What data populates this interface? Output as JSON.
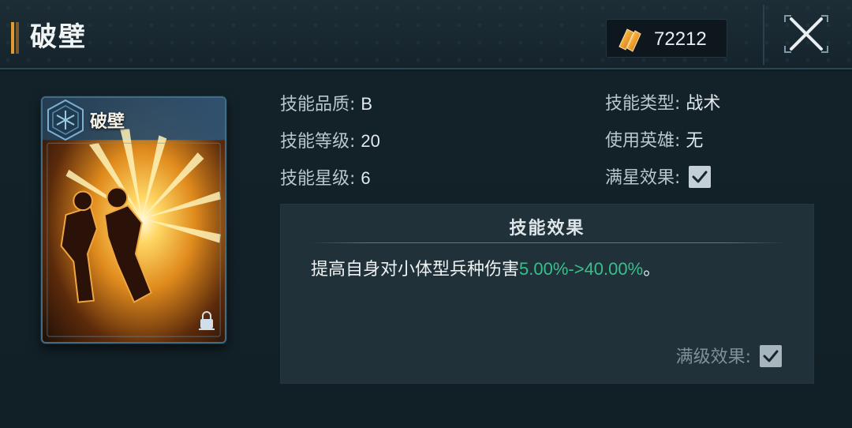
{
  "header": {
    "title": "破壁",
    "currency": {
      "icon": "crystal-icon",
      "value": "72212"
    },
    "close_icon": "close-icon"
  },
  "card": {
    "name": "破壁",
    "emblem_icon": "hex-emblem-icon",
    "lock_icon": "lock-icon"
  },
  "stats": {
    "quality": {
      "label": "技能品质:",
      "value": "B"
    },
    "level": {
      "label": "技能等级:",
      "value": "20"
    },
    "stars": {
      "label": "技能星级:",
      "value": "6"
    },
    "type": {
      "label": "技能类型:",
      "value": "战术"
    },
    "hero": {
      "label": "使用英雄:",
      "value": "无"
    },
    "max_star_effect": {
      "label": "满星效果:",
      "checked": true
    }
  },
  "effect": {
    "title": "技能效果",
    "text_prefix": "提高自身对小体型兵种伤害",
    "text_highlight": "5.00%->40.00%",
    "text_suffix": "。",
    "max_level_label": "满级效果:",
    "max_level_checked": true
  },
  "colors": {
    "accent_orange": "#e39a2f",
    "highlight_green": "#37c08a",
    "background": "#0f1b22"
  }
}
